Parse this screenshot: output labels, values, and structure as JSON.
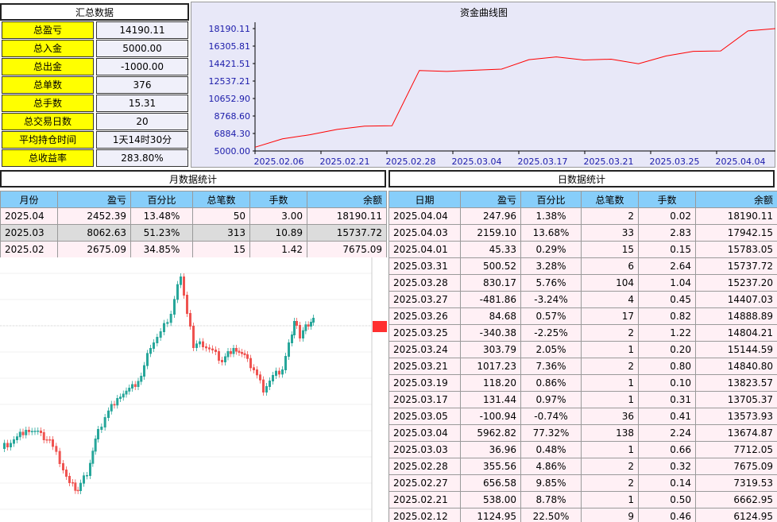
{
  "summary": {
    "title": "汇总数据",
    "rows": [
      {
        "label": "总盈亏",
        "value": "14190.11"
      },
      {
        "label": "总入金",
        "value": "5000.00"
      },
      {
        "label": "总出金",
        "value": "-1000.00"
      },
      {
        "label": "总单数",
        "value": "376"
      },
      {
        "label": "总手数",
        "value": "15.31"
      },
      {
        "label": "总交易日数",
        "value": "20"
      },
      {
        "label": "平均持仓时间",
        "value": "1天14时30分"
      },
      {
        "label": "总收益率",
        "value": "283.80%"
      }
    ]
  },
  "chart_data": {
    "type": "line",
    "title": "资金曲线图",
    "yticks": [
      "18190.11",
      "16305.81",
      "14421.51",
      "12537.21",
      "10652.90",
      "8768.60",
      "6884.30",
      "5000.00"
    ],
    "ylim": [
      5000.0,
      18190.11
    ],
    "xticks": [
      "2025.02.06",
      "2025.02.21",
      "2025.02.28",
      "2025.03.04",
      "2025.03.17",
      "2025.03.21",
      "2025.03.25",
      "2025.04.04"
    ],
    "series": [
      {
        "values": [
          5400,
          6300,
          6750,
          7320,
          7675,
          7712,
          13675,
          13574,
          13705,
          13824,
          14841,
          15145,
          14804,
          14889,
          14407,
          15237,
          15738,
          15783,
          17942,
          18190
        ]
      }
    ],
    "line_color": "#ff0000",
    "grid": false
  },
  "monthly": {
    "title": "月数据统计",
    "headers": [
      "月份",
      "盈亏",
      "百分比",
      "总笔数",
      "手数",
      "余额"
    ],
    "rows": [
      [
        "2025.04",
        "2452.39",
        "13.48%",
        "50",
        "3.00",
        "18190.11"
      ],
      [
        "2025.03",
        "8062.63",
        "51.23%",
        "313",
        "10.89",
        "15737.72"
      ],
      [
        "2025.02",
        "2675.09",
        "34.85%",
        "15",
        "1.42",
        "7675.09"
      ]
    ]
  },
  "daily": {
    "title": "日数据统计",
    "headers": [
      "日期",
      "盈亏",
      "百分比",
      "总笔数",
      "手数",
      "余额"
    ],
    "rows": [
      [
        "2025.04.04",
        "247.96",
        "1.38%",
        "2",
        "0.02",
        "18190.11"
      ],
      [
        "2025.04.03",
        "2159.10",
        "13.68%",
        "33",
        "2.83",
        "17942.15"
      ],
      [
        "2025.04.01",
        "45.33",
        "0.29%",
        "15",
        "0.15",
        "15783.05"
      ],
      [
        "2025.03.31",
        "500.52",
        "3.28%",
        "6",
        "2.64",
        "15737.72"
      ],
      [
        "2025.03.28",
        "830.17",
        "5.76%",
        "104",
        "1.04",
        "15237.20"
      ],
      [
        "2025.03.27",
        "-481.86",
        "-3.24%",
        "4",
        "0.45",
        "14407.03"
      ],
      [
        "2025.03.26",
        "84.68",
        "0.57%",
        "17",
        "0.82",
        "14888.89"
      ],
      [
        "2025.03.25",
        "-340.38",
        "-2.25%",
        "2",
        "1.22",
        "14804.21"
      ],
      [
        "2025.03.24",
        "303.79",
        "2.05%",
        "1",
        "0.20",
        "15144.59"
      ],
      [
        "2025.03.21",
        "1017.23",
        "7.36%",
        "2",
        "0.80",
        "14840.80"
      ],
      [
        "2025.03.19",
        "118.20",
        "0.86%",
        "1",
        "0.10",
        "13823.57"
      ],
      [
        "2025.03.17",
        "131.44",
        "0.97%",
        "1",
        "0.31",
        "13705.37"
      ],
      [
        "2025.03.05",
        "-100.94",
        "-0.74%",
        "36",
        "0.41",
        "13573.93"
      ],
      [
        "2025.03.04",
        "5962.82",
        "77.32%",
        "138",
        "2.24",
        "13674.87"
      ],
      [
        "2025.03.03",
        "36.96",
        "0.48%",
        "1",
        "0.66",
        "7712.05"
      ],
      [
        "2025.02.28",
        "355.56",
        "4.86%",
        "2",
        "0.32",
        "7675.09"
      ],
      [
        "2025.02.27",
        "656.58",
        "9.85%",
        "2",
        "0.14",
        "7319.53"
      ],
      [
        "2025.02.21",
        "538.00",
        "8.78%",
        "1",
        "0.50",
        "6662.95"
      ],
      [
        "2025.02.12",
        "1124.95",
        "22.50%",
        "9",
        "0.46",
        "6124.95"
      ]
    ]
  }
}
